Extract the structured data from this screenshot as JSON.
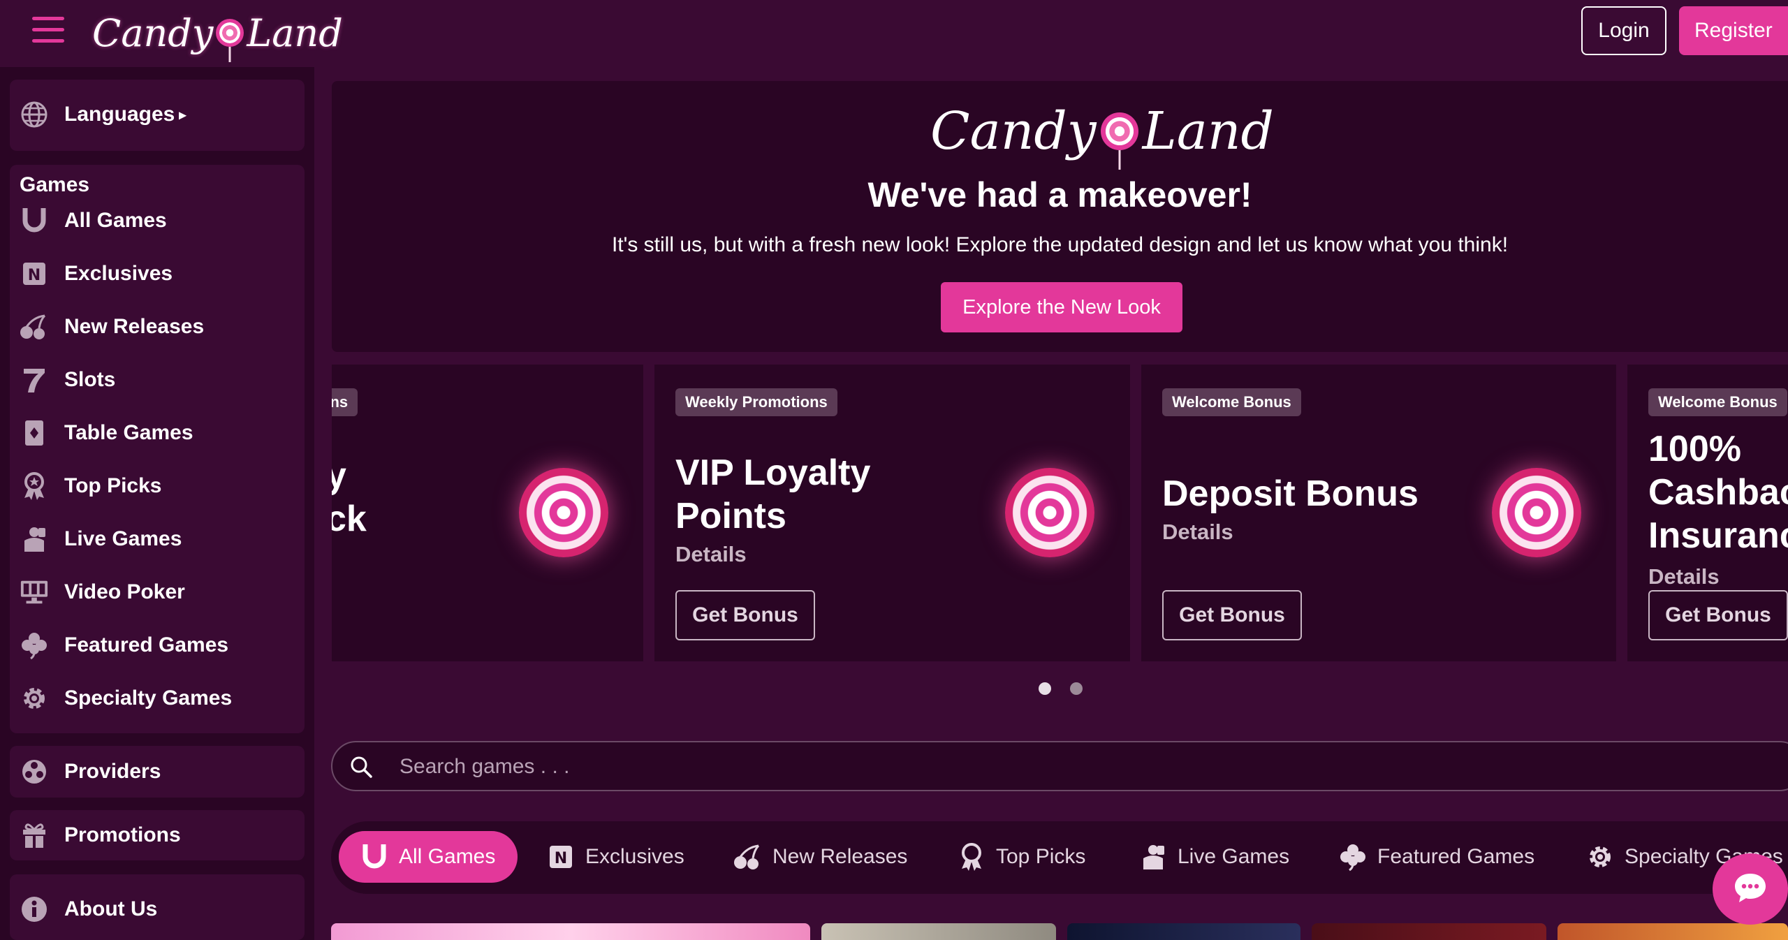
{
  "header": {
    "logo_left": "Candy",
    "logo_right": "Land",
    "login_label": "Login",
    "register_label": "Register"
  },
  "sidebar": {
    "languages_label": "Languages",
    "games_heading": "Games",
    "games_items": [
      {
        "label": "All Games",
        "icon": "horseshoe-icon"
      },
      {
        "label": "Exclusives",
        "icon": "exclusive-icon"
      },
      {
        "label": "New Releases",
        "icon": "cherries-icon"
      },
      {
        "label": "Slots",
        "icon": "seven-icon"
      },
      {
        "label": "Table Games",
        "icon": "card-icon"
      },
      {
        "label": "Top Picks",
        "icon": "award-icon"
      },
      {
        "label": "Live Games",
        "icon": "dealer-icon"
      },
      {
        "label": "Video Poker",
        "icon": "monitor-icon"
      },
      {
        "label": "Featured Games",
        "icon": "clover-icon"
      },
      {
        "label": "Specialty Games",
        "icon": "gear-icon"
      }
    ],
    "providers_label": "Providers",
    "promotions_label": "Promotions",
    "about_label": "About Us"
  },
  "banner": {
    "logo_left": "Candy",
    "logo_right": "Land",
    "title": "We've had a makeover!",
    "subtitle": "It's still us, but with a fresh new look! Explore the updated design and let us know what you think!",
    "cta_label": "Explore the New Look"
  },
  "promos": [
    {
      "tag": "ons",
      "title_line1": "y",
      "title_line2": "ck",
      "details": "",
      "button": ""
    },
    {
      "tag": "Weekly Promotions",
      "title_line1": "VIP Loyalty",
      "title_line2": "Points",
      "details": "Details",
      "button": "Get Bonus"
    },
    {
      "tag": "Welcome Bonus",
      "title_line1": "Deposit Bonus",
      "title_line2": "",
      "details": "Details",
      "button": "Get Bonus"
    },
    {
      "tag": "Welcome Bonus",
      "title_line1": "100%",
      "title_line2": "Cashbac",
      "title_line3": "Insuranc",
      "details": "Details",
      "button": "Get Bonus"
    }
  ],
  "carousel": {
    "dots": 2,
    "active_index": 0
  },
  "search": {
    "placeholder": "Search games . . ."
  },
  "tabs": [
    {
      "label": "All Games",
      "icon": "horseshoe-icon",
      "active": true
    },
    {
      "label": "Exclusives",
      "icon": "exclusive-icon",
      "active": false
    },
    {
      "label": "New Releases",
      "icon": "cherries-icon",
      "active": false
    },
    {
      "label": "Top Picks",
      "icon": "award-icon",
      "active": false
    },
    {
      "label": "Live Games",
      "icon": "dealer-icon",
      "active": false
    },
    {
      "label": "Featured Games",
      "icon": "clover-icon",
      "active": false
    },
    {
      "label": "Specialty Games",
      "icon": "gear-icon",
      "active": false
    }
  ],
  "colors": {
    "background": "#3a0a33",
    "panel": "#2a0524",
    "accent": "#e3389a",
    "muted_text": "#c9b6c4"
  }
}
